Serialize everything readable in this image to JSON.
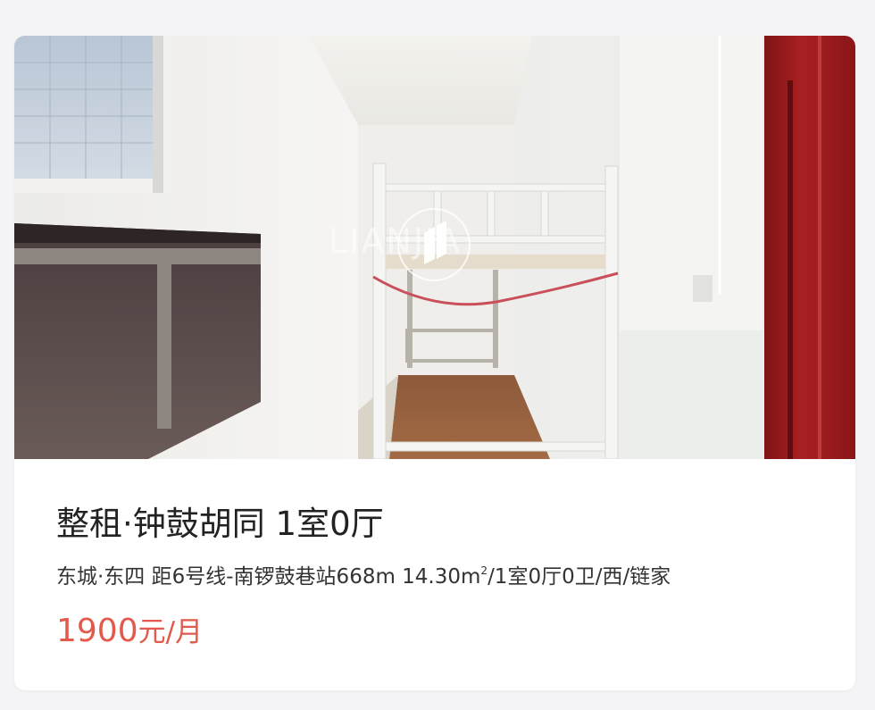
{
  "listing": {
    "photo": {
      "icon": "room-photo",
      "watermark_text": "LIANJIA",
      "watermark_icon": "lianjia-logo-icon"
    },
    "title": "整租·钟鼓胡同 1室0厅",
    "meta_prefix": "东城·东四 距6号线-南锣鼓巷站668m 14.30m",
    "meta_sup": "2",
    "meta_suffix": "/1室0厅0卫/西/链家",
    "price_amount": "1900",
    "price_unit": "元/月",
    "colors": {
      "price": "#e25a4c",
      "title": "#222222",
      "door_red": "#9e1a1c"
    }
  }
}
